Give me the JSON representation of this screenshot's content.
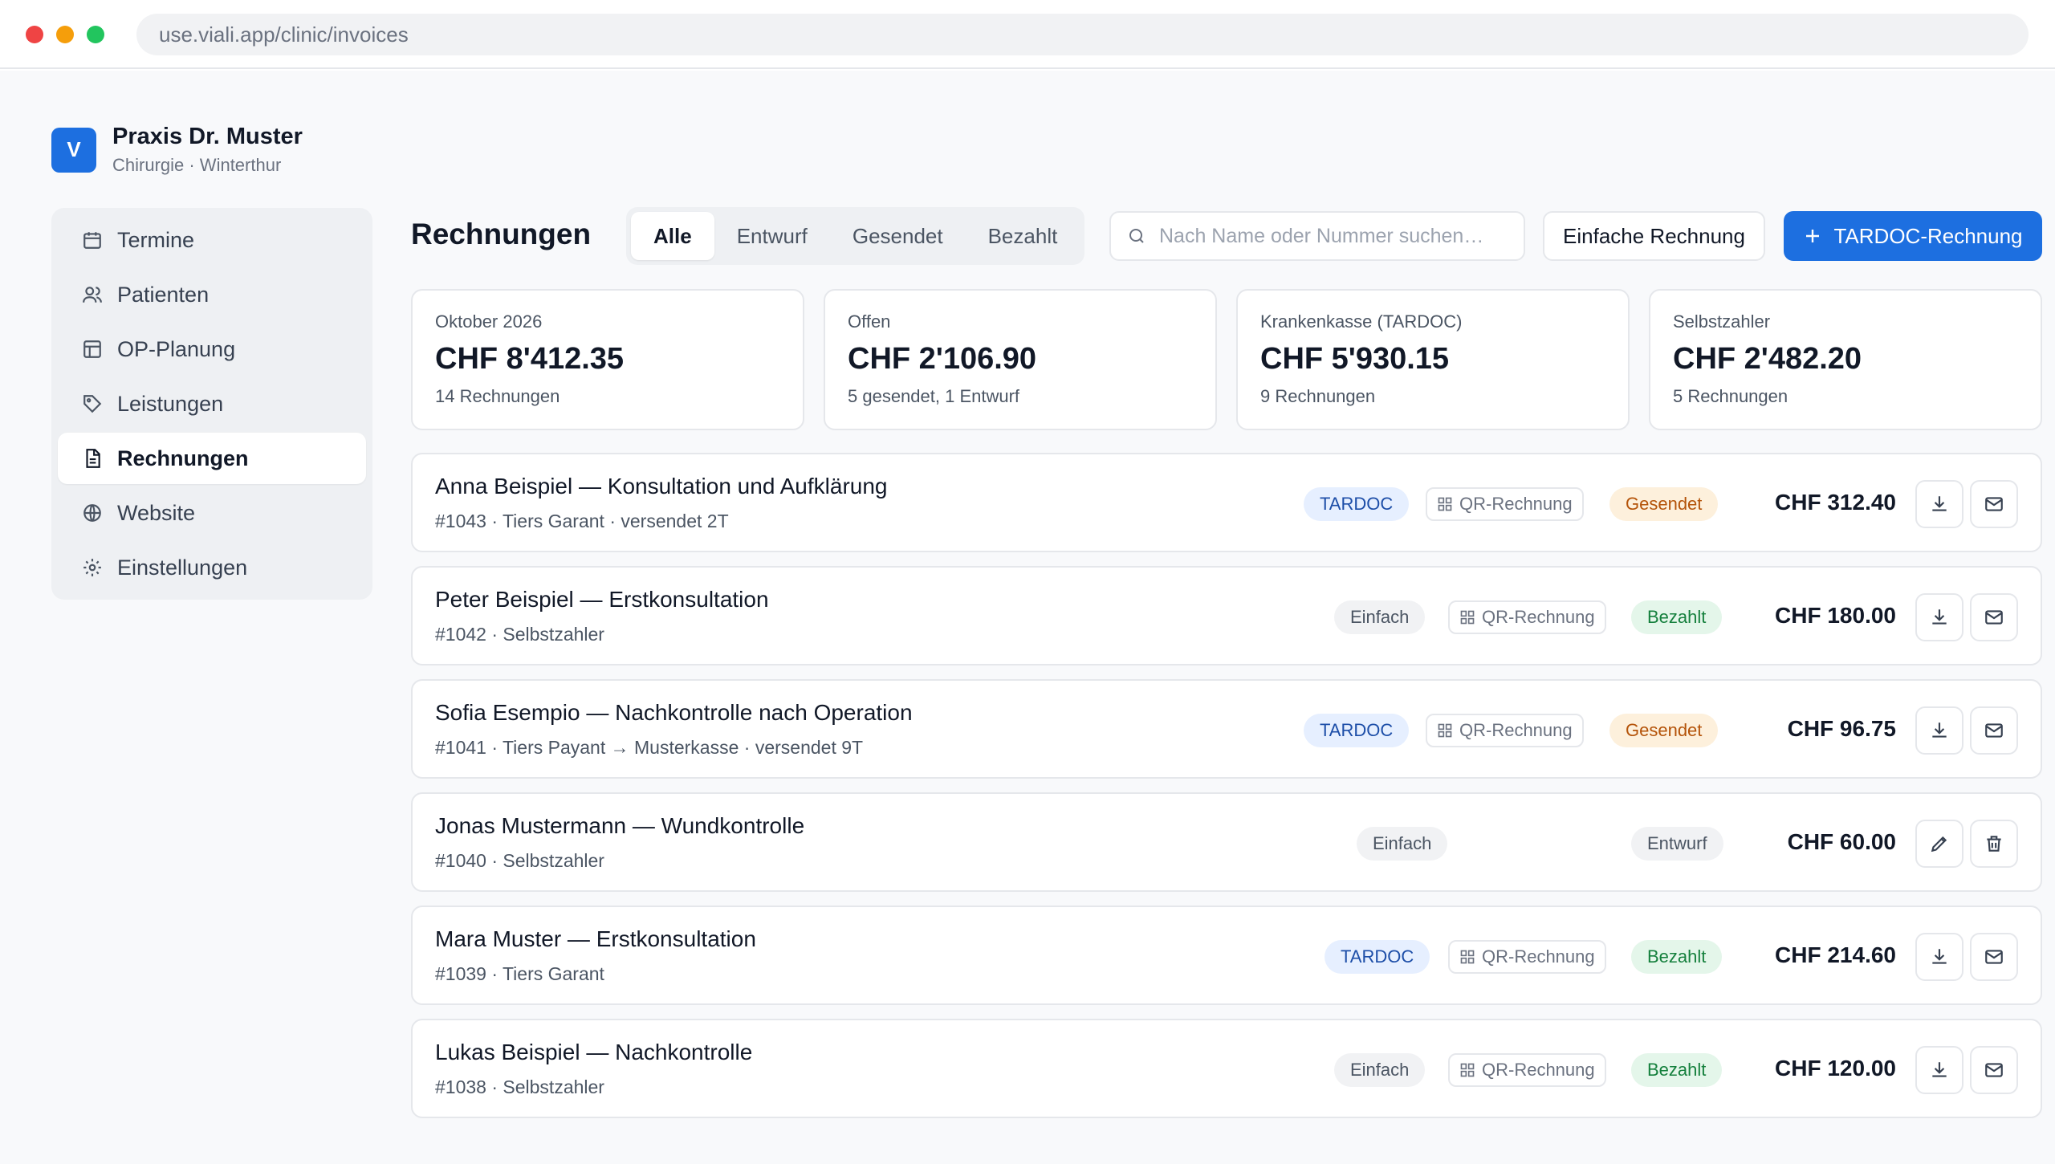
{
  "browser": {
    "url": "use.viali.app/clinic/invoices"
  },
  "brand": {
    "logo_letter": "V",
    "name": "Praxis Dr. Muster",
    "subtitle": "Chirurgie · Winterthur"
  },
  "sidebar": {
    "items": [
      {
        "label": "Termine",
        "icon": "calendar-icon"
      },
      {
        "label": "Patienten",
        "icon": "users-icon"
      },
      {
        "label": "OP-Planung",
        "icon": "layout-icon"
      },
      {
        "label": "Leistungen",
        "icon": "tag-icon"
      },
      {
        "label": "Rechnungen",
        "icon": "file-text-icon",
        "active": true
      },
      {
        "label": "Website",
        "icon": "globe-icon"
      },
      {
        "label": "Einstellungen",
        "icon": "gear-icon"
      }
    ]
  },
  "header": {
    "title": "Rechnungen",
    "tabs": [
      "Alle",
      "Entwurf",
      "Gesendet",
      "Bezahlt"
    ],
    "active_tab": "Alle",
    "search_placeholder": "Nach Name oder Nummer suchen…",
    "simple_invoice_label": "Einfache Rechnung",
    "tardoc_invoice_label": "TARDOC-Rechnung"
  },
  "stats": [
    {
      "label": "Oktober 2026",
      "value": "CHF 8'412.35",
      "sub": "14 Rechnungen"
    },
    {
      "label": "Offen",
      "value": "CHF 2'106.90",
      "sub": "5 gesendet, 1 Entwurf"
    },
    {
      "label": "Krankenkasse (TARDOC)",
      "value": "CHF 5'930.15",
      "sub": "9 Rechnungen"
    },
    {
      "label": "Selbstzahler",
      "value": "CHF 2'482.20",
      "sub": "5 Rechnungen"
    }
  ],
  "invoices": [
    {
      "title": "Anna Beispiel — Konsultation und Aufklärung",
      "meta": "#1043 · Tiers Garant · versendet 2T",
      "type": "TARDOC",
      "qr": "QR-Rechnung",
      "status": "Gesendet",
      "amount": "CHF 312.40"
    },
    {
      "title": "Peter Beispiel — Erstkonsultation",
      "meta": "#1042 · Selbstzahler",
      "type": "Einfach",
      "qr": "QR-Rechnung",
      "status": "Bezahlt",
      "amount": "CHF 180.00"
    },
    {
      "title": "Sofia Esempio — Nachkontrolle nach Operation",
      "meta": "#1041 · Tiers Payant → Musterkasse · versendet 9T",
      "type": "TARDOC",
      "qr": "QR-Rechnung",
      "status": "Gesendet",
      "amount": "CHF 96.75"
    },
    {
      "title": "Jonas Mustermann — Wundkontrolle",
      "meta": "#1040 · Selbstzahler",
      "type": "Einfach",
      "qr": "",
      "status": "Entwurf",
      "amount": "CHF 60.00"
    },
    {
      "title": "Mara Muster — Erstkonsultation",
      "meta": "#1039 · Tiers Garant",
      "type": "TARDOC",
      "qr": "QR-Rechnung",
      "status": "Bezahlt",
      "amount": "CHF 214.60"
    },
    {
      "title": "Lukas Beispiel — Nachkontrolle",
      "meta": "#1038 · Selbstzahler",
      "type": "Einfach",
      "qr": "QR-Rechnung",
      "status": "Bezahlt",
      "amount": "CHF 120.00"
    }
  ],
  "colors": {
    "accent": "#1d6fe0",
    "tardoc": "#1d4ea8",
    "gesendet": "#b45309",
    "bezahlt": "#15803d"
  }
}
